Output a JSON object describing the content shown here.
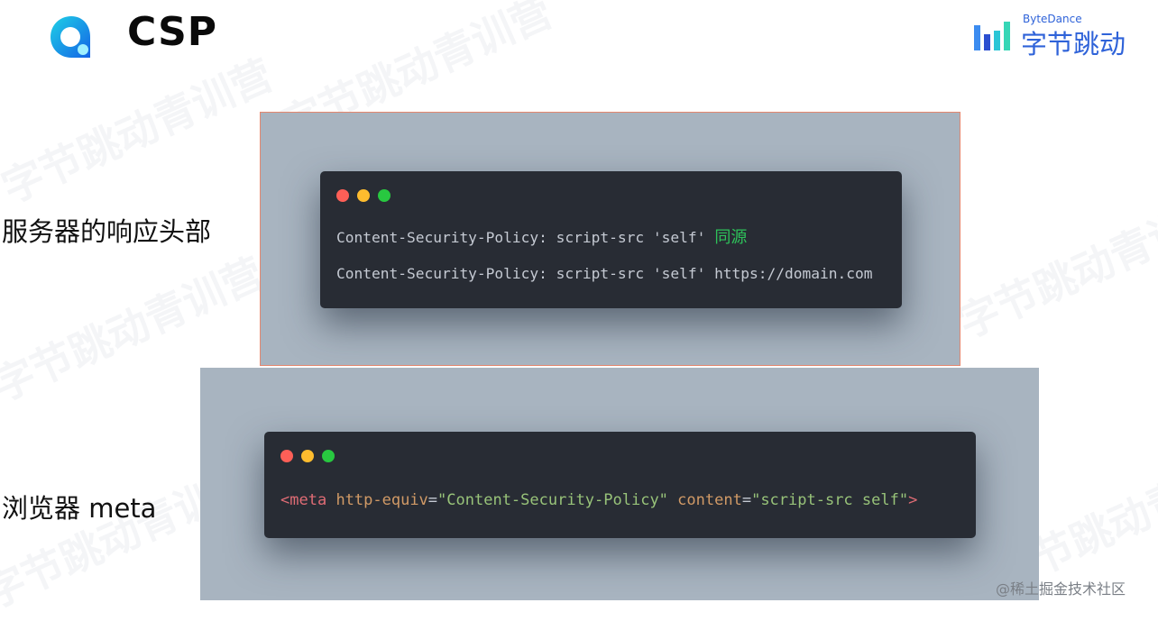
{
  "header": {
    "title": "CSP",
    "brand_en": "ByteDance",
    "brand_cn": "字节跳动"
  },
  "watermark": {
    "text": "字节跳动青训营"
  },
  "sections": {
    "server_label": "服务器的响应头部",
    "meta_label": "浏览器 meta"
  },
  "code_top": {
    "line1": "Content-Security-Policy: script-src 'self'",
    "line1_note": "同源",
    "line2": "Content-Security-Policy: script-src 'self' https://domain.com"
  },
  "code_bottom": {
    "tag_open": "<meta",
    "attr1": "http-equiv",
    "eq1": "=",
    "val1": "\"Content-Security-Policy\"",
    "attr2": "content",
    "eq2": "=",
    "val2": "\"script-src self\"",
    "tag_close": ">"
  },
  "footer": {
    "credit": "@稀土掘金技术社区"
  },
  "colors": {
    "brand_blue": "#2f63d9",
    "code_bg": "#282c34",
    "panel_bg": "#a8b4c0",
    "note_green": "#2ec25a"
  }
}
